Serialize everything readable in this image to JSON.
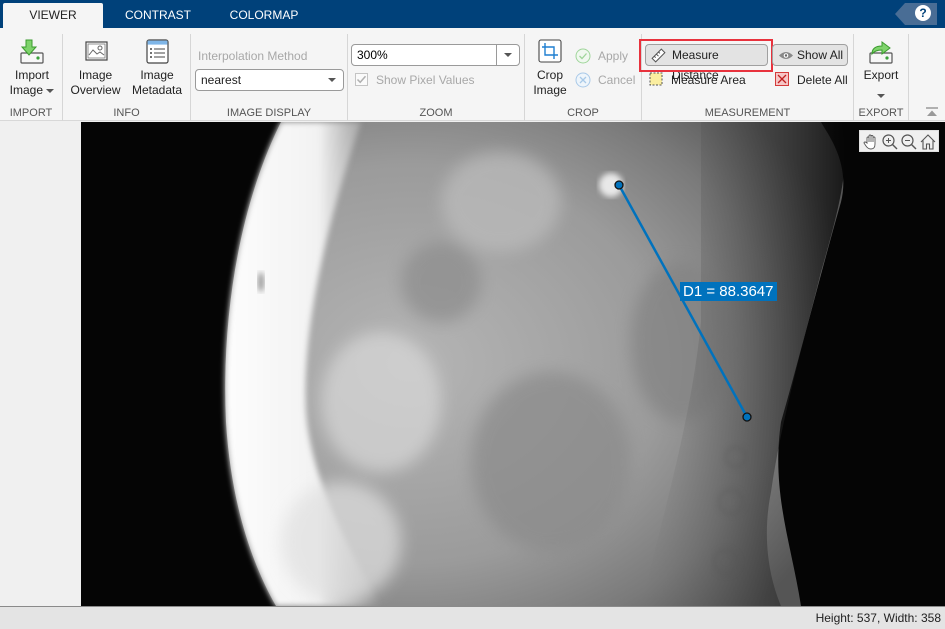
{
  "tabs": [
    {
      "label": "VIEWER",
      "active": true
    },
    {
      "label": "CONTRAST",
      "active": false
    },
    {
      "label": "COLORMAP",
      "active": false
    }
  ],
  "help": {
    "label": "?"
  },
  "toolstrip": {
    "import": {
      "section_label": "IMPORT",
      "import_image": {
        "line1": "Import",
        "line2": "Image"
      }
    },
    "info": {
      "section_label": "INFO",
      "image_overview": {
        "line1": "Image",
        "line2": "Overview"
      },
      "image_metadata": {
        "line1": "Image",
        "line2": "Metadata"
      }
    },
    "image_display": {
      "section_label": "IMAGE DISPLAY",
      "interpolation_label": "Interpolation Method",
      "interpolation_value": "nearest"
    },
    "zoom": {
      "section_label": "ZOOM",
      "zoom_value": "300%",
      "show_pixel_values_label": "Show Pixel Values",
      "show_pixel_values_checked": true
    },
    "crop": {
      "section_label": "CROP",
      "crop_image": {
        "line1": "Crop",
        "line2": "Image"
      },
      "apply_label": "Apply",
      "cancel_label": "Cancel"
    },
    "measurement": {
      "section_label": "MEASUREMENT",
      "measure_distance_label": "Measure Distance",
      "measure_area_label": "Measure Area",
      "show_all_label": "Show All",
      "delete_all_label": "Delete All"
    },
    "export": {
      "section_label": "EXPORT",
      "export_label": "Export"
    }
  },
  "viewer": {
    "measurement": {
      "name": "D1",
      "value": "88.3647",
      "text": "D1 = 88.3647",
      "color": "#0072bd"
    },
    "axes_toolbar": [
      "pan-icon",
      "zoom-in-icon",
      "zoom-out-icon",
      "home-icon"
    ]
  },
  "status": {
    "text": "Height: 537, Width: 358"
  }
}
